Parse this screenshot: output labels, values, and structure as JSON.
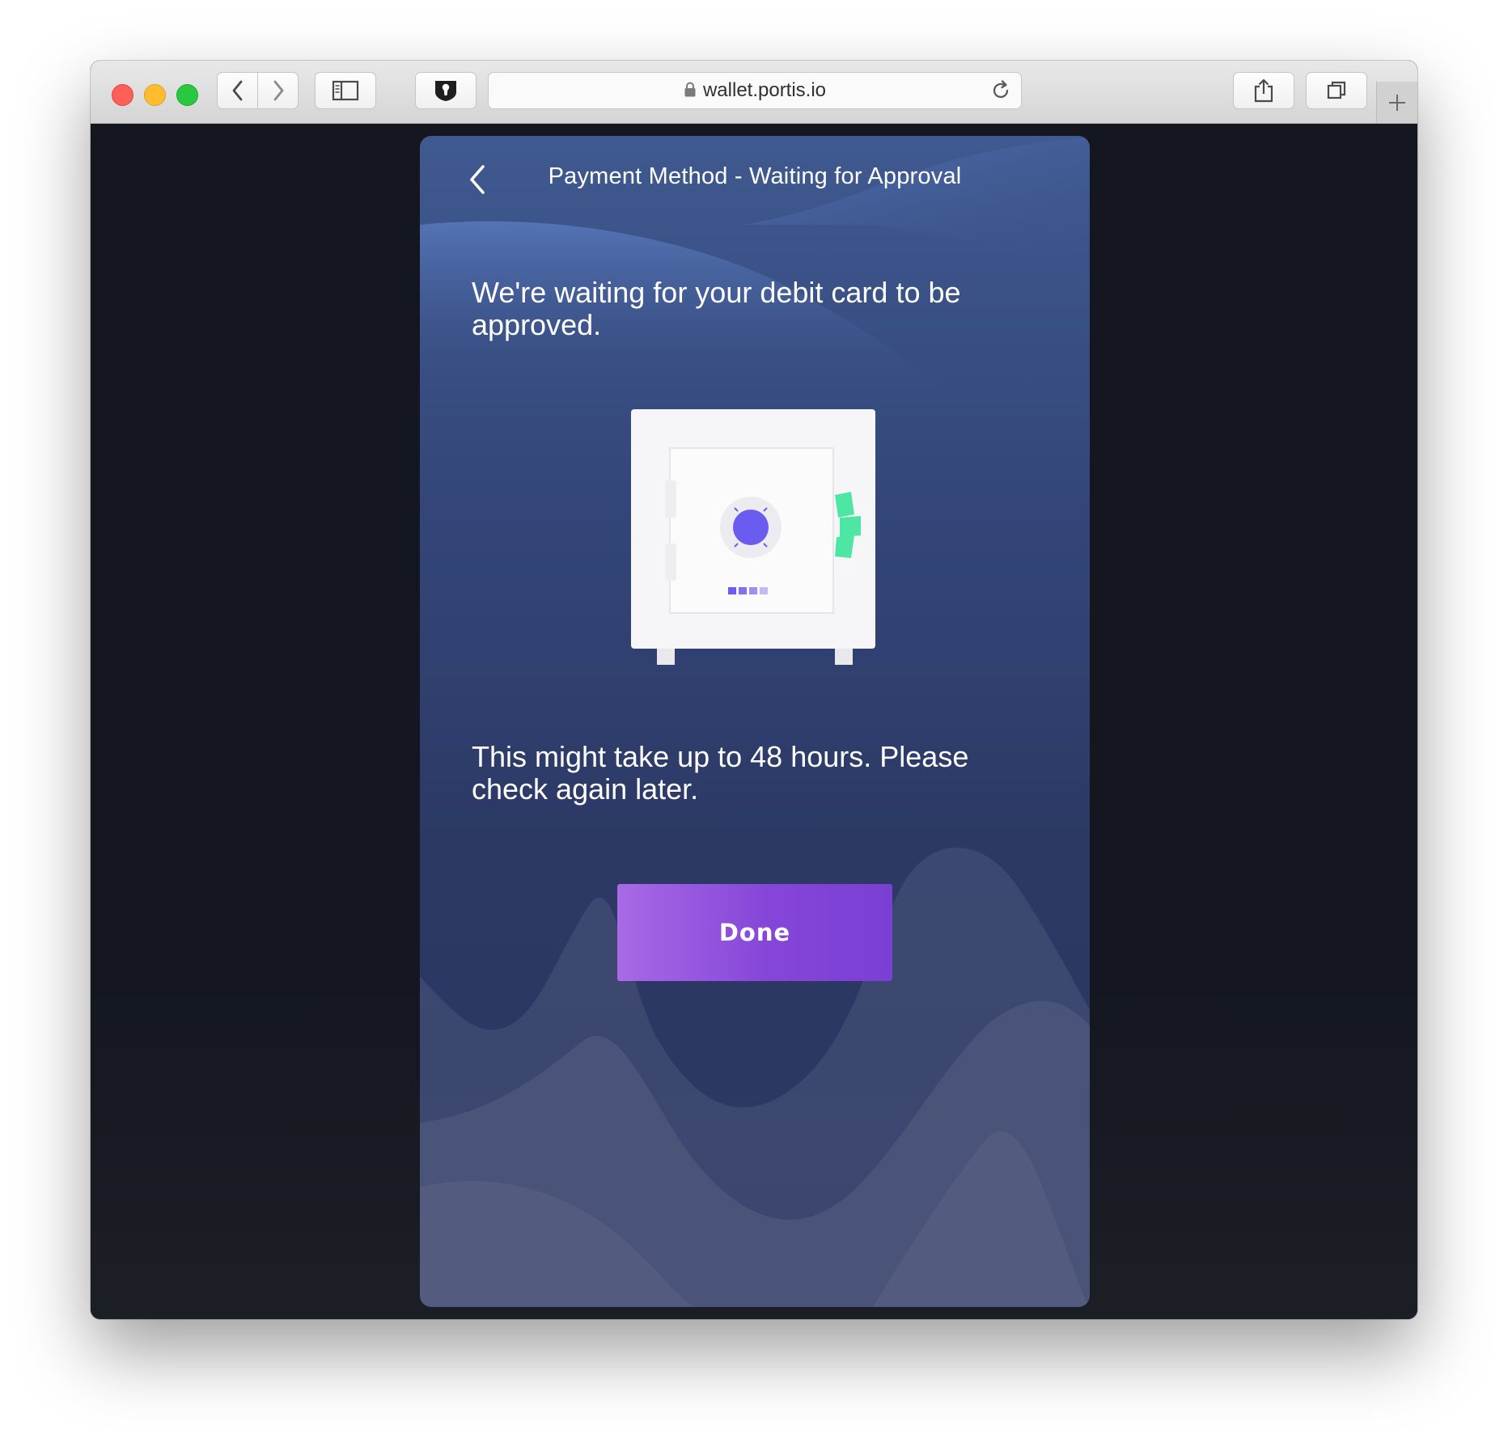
{
  "browser": {
    "url": "wallet.portis.io"
  },
  "screen": {
    "title": "Payment Method - Waiting for Approval",
    "message_primary": "We're waiting for your debit card to be approved.",
    "message_secondary": "This might take up to 48 hours. Please check again later.",
    "done_label": "Done"
  },
  "colors": {
    "panel_top": "#3f5a90",
    "panel_bottom": "#2d3762",
    "button_start": "#a86ae6",
    "button_end": "#7a3fd4",
    "dial": "#6b5cf0",
    "cash": "#4ee6a4"
  }
}
